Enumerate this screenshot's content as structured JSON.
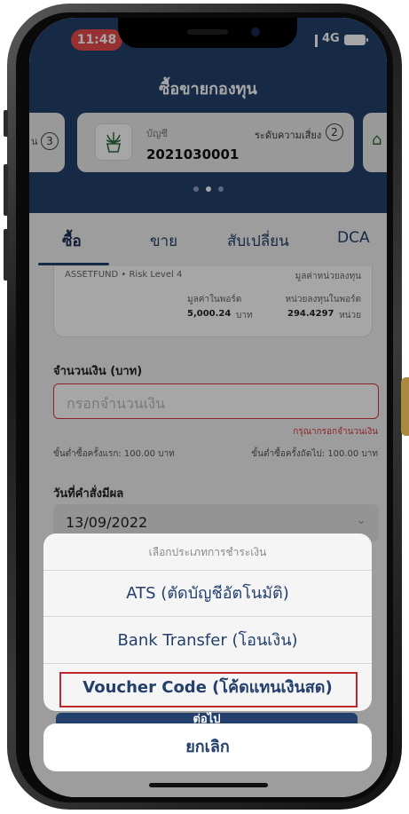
{
  "status_bar": {
    "time": "11:48",
    "network": "4G"
  },
  "header": {
    "title": "ซื้อขายกองทุน"
  },
  "account_card": {
    "account_label": "บัญชี",
    "account_number": "2021030001",
    "risk_label": "ระดับความเสี่ยง",
    "risk_value": "2",
    "left_card_text": "น",
    "left_card_number": "3"
  },
  "tabs": [
    {
      "label": "ซื้อ",
      "active": true
    },
    {
      "label": "ขาย",
      "active": false
    },
    {
      "label": "สับเปลี่ยน",
      "active": false
    },
    {
      "label": "DCA",
      "active": false
    }
  ],
  "fund": {
    "name_risk": "ASSETFUND • Risk Level 4",
    "nav_label": "มูลค่าหน่วยลงทุน",
    "portfolio_value_label": "มูลค่าในพอร์ต",
    "portfolio_value": "5,000.24",
    "portfolio_value_unit": "บาท",
    "units_label": "หน่วยลงทุนในพอร์ต",
    "units_value": "294.4297",
    "units_unit": "หน่วย"
  },
  "amount": {
    "label": "จำนวนเงิน (บาท)",
    "placeholder": "กรอกจำนวนเงิน",
    "error": "กรุณากรอกจำนวนเงิน",
    "min_first": "ขั้นต่ำซื้อครั้งแรก: 100.00 บาท",
    "min_next": "ขั้นต่ำซื้อครั้งถัดไป: 100.00 บาท"
  },
  "effective_date": {
    "label": "วันที่คำสั่งมีผล",
    "value": "13/09/2022"
  },
  "action_sheet": {
    "title": "เลือกประเภทการชำระเงิน",
    "options": [
      "ATS (ตัดบัญชีอัตโนมัติ)",
      "Bank Transfer (โอนเงิน)",
      "Voucher Code (โค้ดแทนเงินสด)"
    ],
    "cancel": "ยกเลิก",
    "behind_button": "ต่อไป"
  },
  "colors": {
    "navy": "#233f6b",
    "error": "#d9363e",
    "highlight": "#c0272d"
  }
}
